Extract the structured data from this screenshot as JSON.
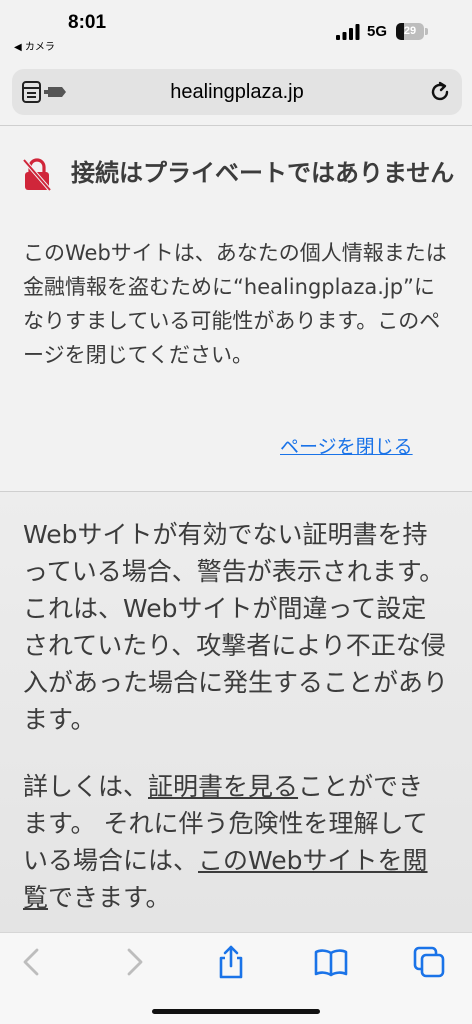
{
  "status_bar": {
    "time": "8:01",
    "back_app": "◀ カメラ",
    "network": "5G",
    "battery_level": "29",
    "battery_fraction": 0.29,
    "icons": [
      "signal-bars-icon",
      "battery-icon"
    ]
  },
  "address_bar": {
    "url": "healingplaza.jp",
    "icons": [
      "tabs-icon",
      "reload-icon"
    ]
  },
  "warning": {
    "icon": "broken-lock-icon",
    "title": "接続はプライベートではありません",
    "message": "このWebサイトは、あなたの個人情報または金融情報を盗むために“healingplaza.jp”になりすましている可能性があります。このページを閉じてください。",
    "close_link": "ページを閉じる"
  },
  "details": {
    "paragraph": "Webサイトが有効でない証明書を持っている場合、警告が表示されます。これは、Webサイトが間違って設定されていたり、攻撃者により不正な侵入があった場合に発生することがあります。",
    "more_prefix": "詳しくは、",
    "view_certificate_link": "証明書を見る",
    "more_middle": "ことができます。 それに伴う危険性を理解している場合には、",
    "visit_site_link": "このWebサイトを閲覧",
    "more_suffix": "できます。"
  },
  "toolbar": {
    "icons": [
      "back-icon",
      "forward-icon",
      "share-icon",
      "bookmarks-icon",
      "tabs-overview-icon"
    ]
  },
  "colors": {
    "link": "#1a73e8",
    "warning_icon": "#d0263a",
    "toolbar_icon": "#1a73e8"
  }
}
